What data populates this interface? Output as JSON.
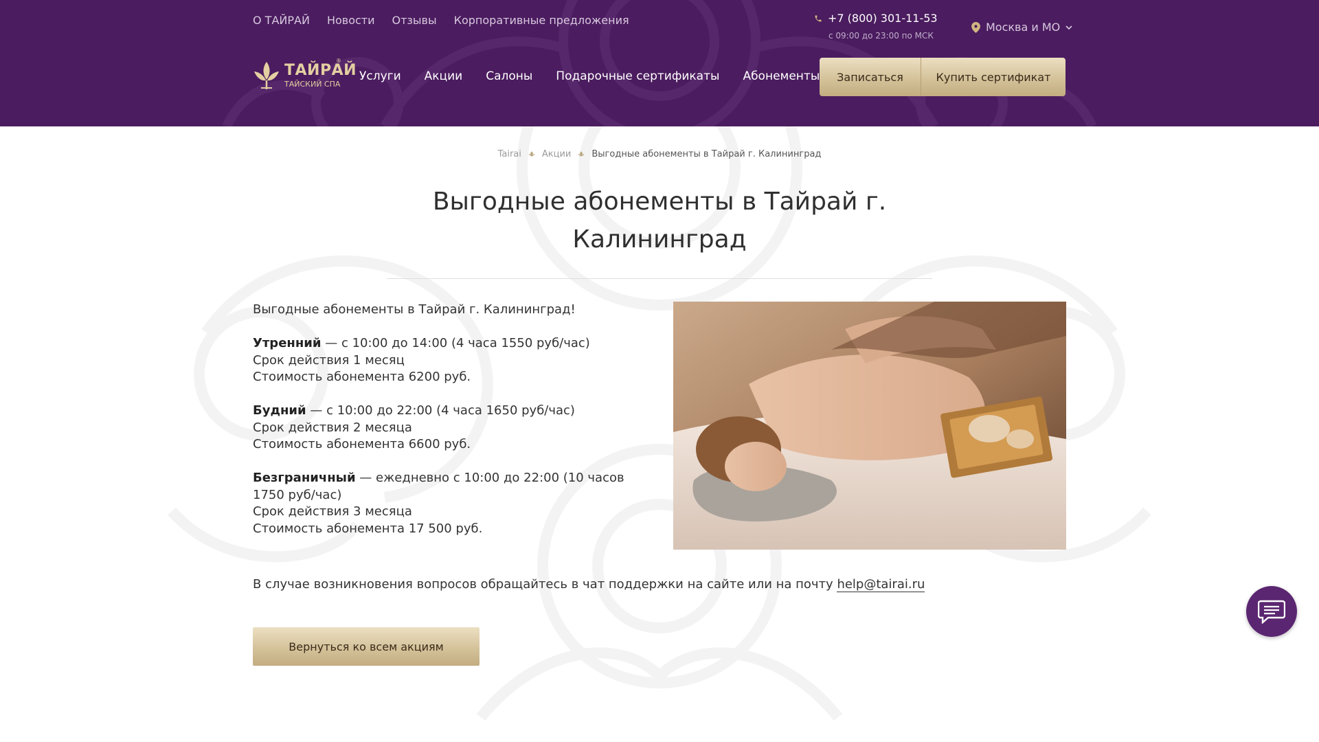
{
  "colors": {
    "header_bg": "#4b1c5f",
    "gold_button": "#d4c29a",
    "chat_button": "#5b2671"
  },
  "header": {
    "top_nav": [
      "О ТАЙРАЙ",
      "Новости",
      "Отзывы",
      "Корпоративные предложения"
    ],
    "phone": "+7 (800) 301-11-53",
    "phone_hours": "с 09:00 до 23:00 по МСК",
    "city": "Москва и МО",
    "logo": {
      "name": "ТАЙРАЙ",
      "subtitle": "ТАЙСКИЙ СПА",
      "reg": "®"
    },
    "main_nav": [
      "Услуги",
      "Акции",
      "Салоны",
      "Подарочные сертификаты",
      "Абонементы"
    ],
    "book_button": "Записаться",
    "cert_button": "Купить сертификат"
  },
  "breadcrumbs": {
    "items": [
      "Tairai",
      "Акции"
    ],
    "current": "Выгодные абонементы в Тайрай г. Калининград"
  },
  "page": {
    "title": "Выгодные абонементы в Тайрай г. Калининград",
    "intro": "Выгодные абонементы в Тайрай г. Калининград!",
    "plans": [
      {
        "name": "Утренний",
        "time": " — с 10:00 до 14:00 (4 часа 1550 руб/час)",
        "validity": "Срок действия 1 месяц",
        "price": "Стоимость абонемента 6200 руб."
      },
      {
        "name": "Будний",
        "time": " — с 10:00 до 22:00 (4 часа 1650 руб/час)",
        "validity": "Срок действия 2 месяца",
        "price": "Стоимость абонемента 6600 руб."
      },
      {
        "name": "Безграничный",
        "time": " — ежедневно с 10:00 до 22:00 (10 часов 1750 руб/час)",
        "validity": "Срок действия 3 месяца",
        "price": "Стоимость абонемента 17 500 руб."
      }
    ],
    "support_text": "В случае возникновения вопросов обращайтесь в чат поддержки на сайте или на почту ",
    "support_email": "help@tairai.ru",
    "back_button": "Вернуться ко всем акциям"
  },
  "icons": {
    "phone": "phone-icon",
    "city": "location-pin-icon",
    "city_dropdown": "chevron-down-icon",
    "logo": "lotus-logo-icon",
    "breadcrumb_separator": "leaf-separator-icon",
    "chat": "chat-icon"
  }
}
